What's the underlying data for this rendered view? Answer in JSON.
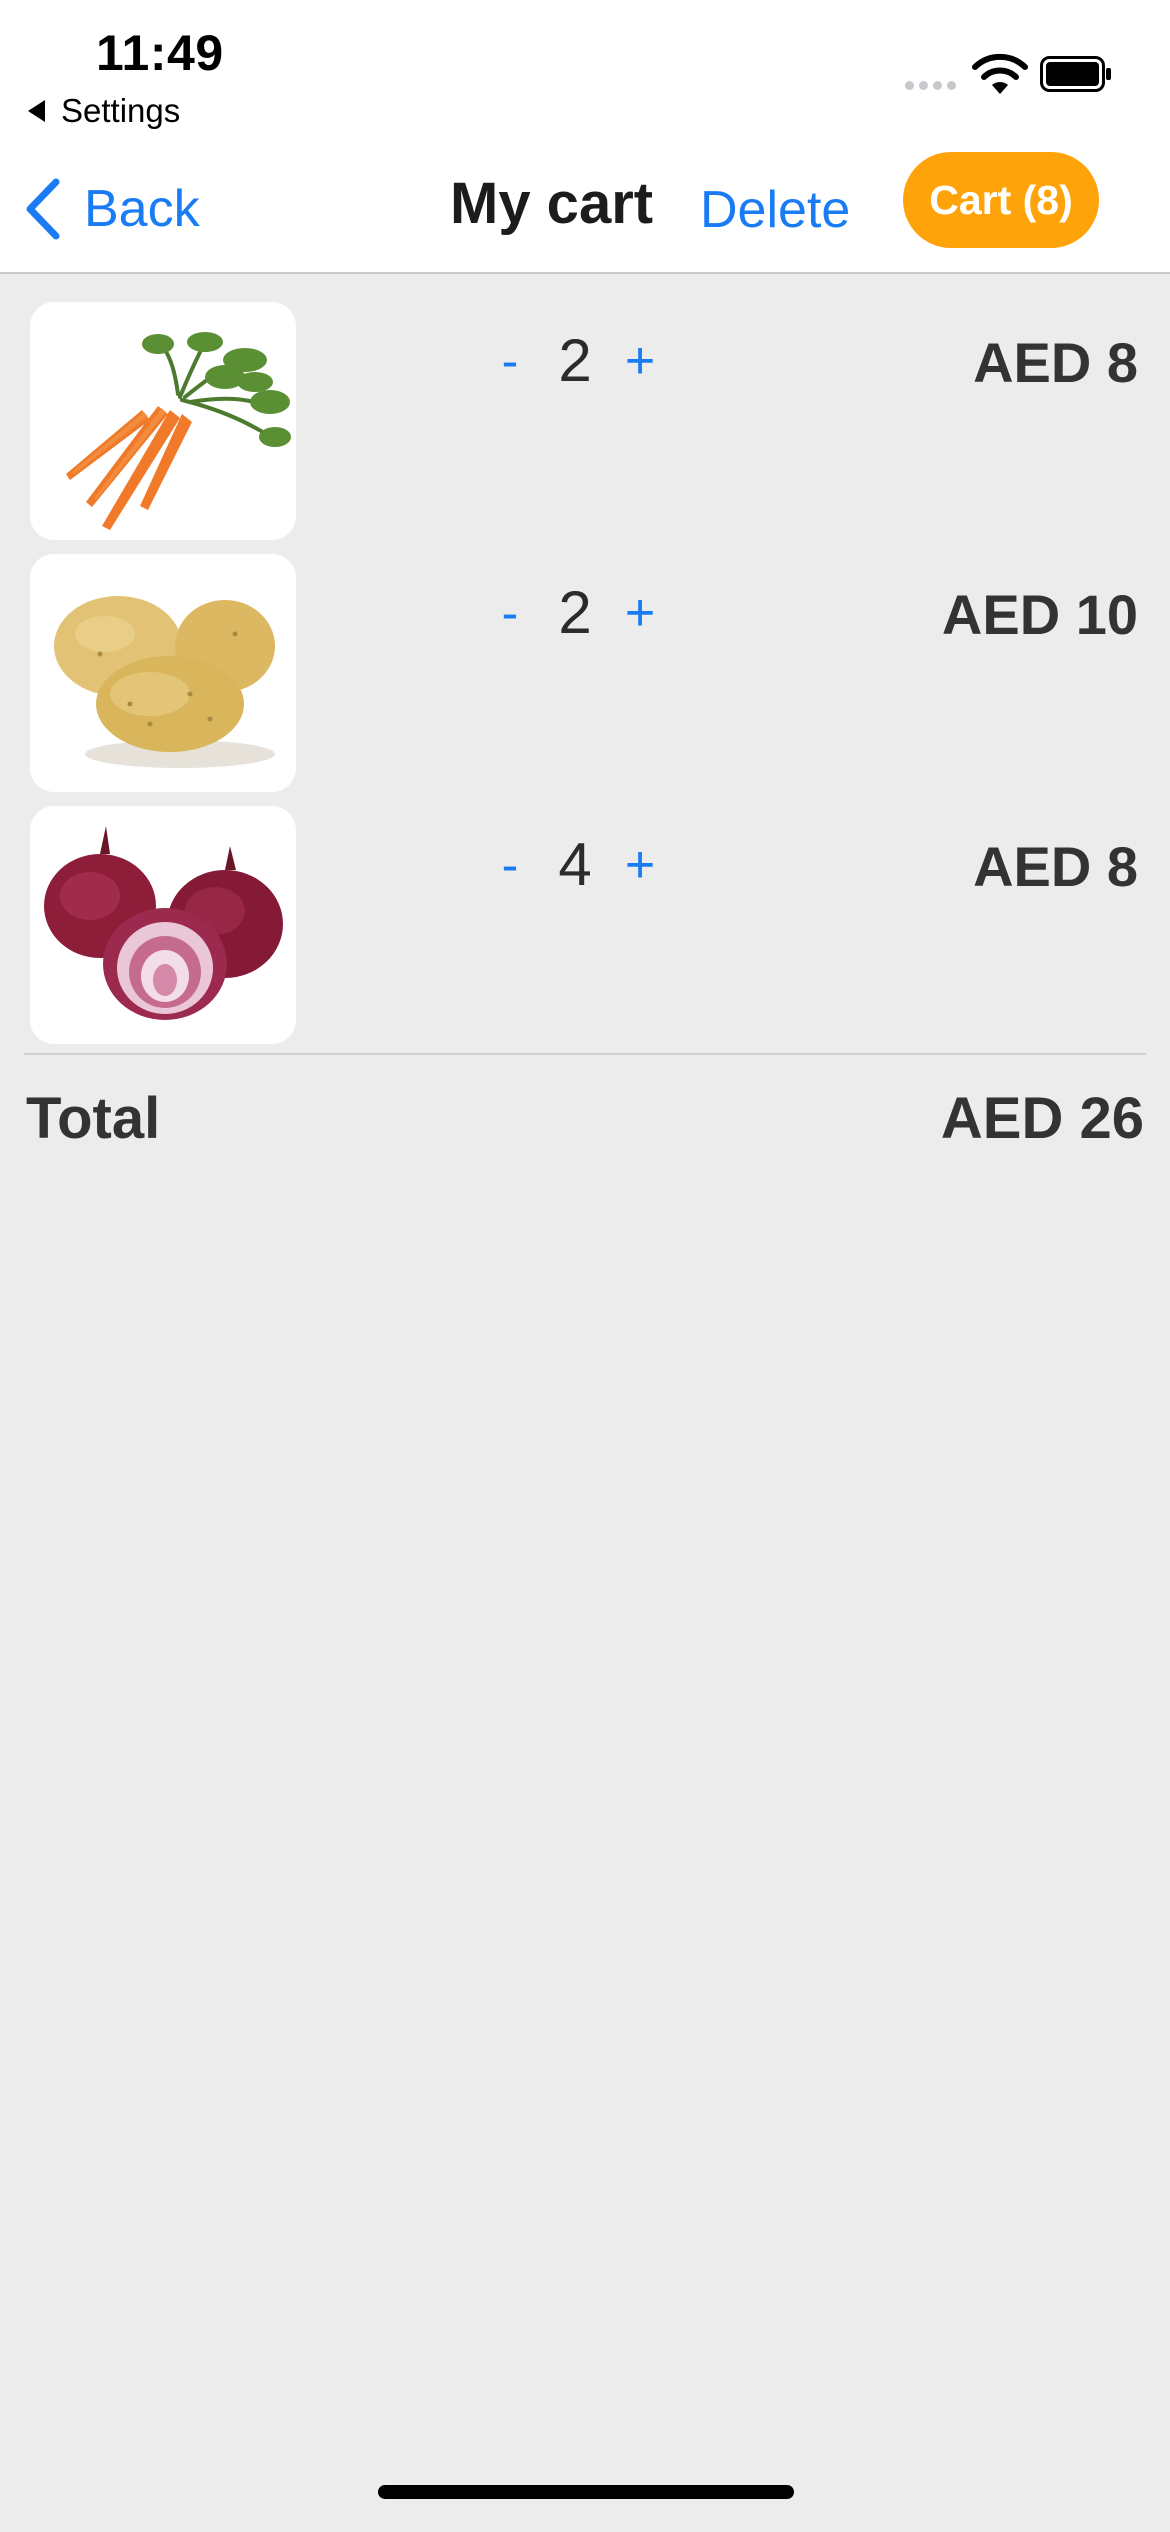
{
  "status_bar": {
    "time": "11:49",
    "back_app": "Settings"
  },
  "nav": {
    "back_label": "Back",
    "title": "My cart",
    "delete_label": "Delete",
    "cart_label": "Cart (8)"
  },
  "items": [
    {
      "image": "carrot-image",
      "minus": "-",
      "quantity": "2",
      "plus": "+",
      "price": "AED 8"
    },
    {
      "image": "potato-image",
      "minus": "-",
      "quantity": "2",
      "plus": "+",
      "price": "AED 10"
    },
    {
      "image": "onion-image",
      "minus": "-",
      "quantity": "4",
      "plus": "+",
      "price": "AED 8"
    }
  ],
  "total": {
    "label": "Total",
    "value": "AED 26"
  },
  "colors": {
    "accent": "#1a7cf5",
    "cart_pill": "#fea40a",
    "background": "#ececed"
  }
}
